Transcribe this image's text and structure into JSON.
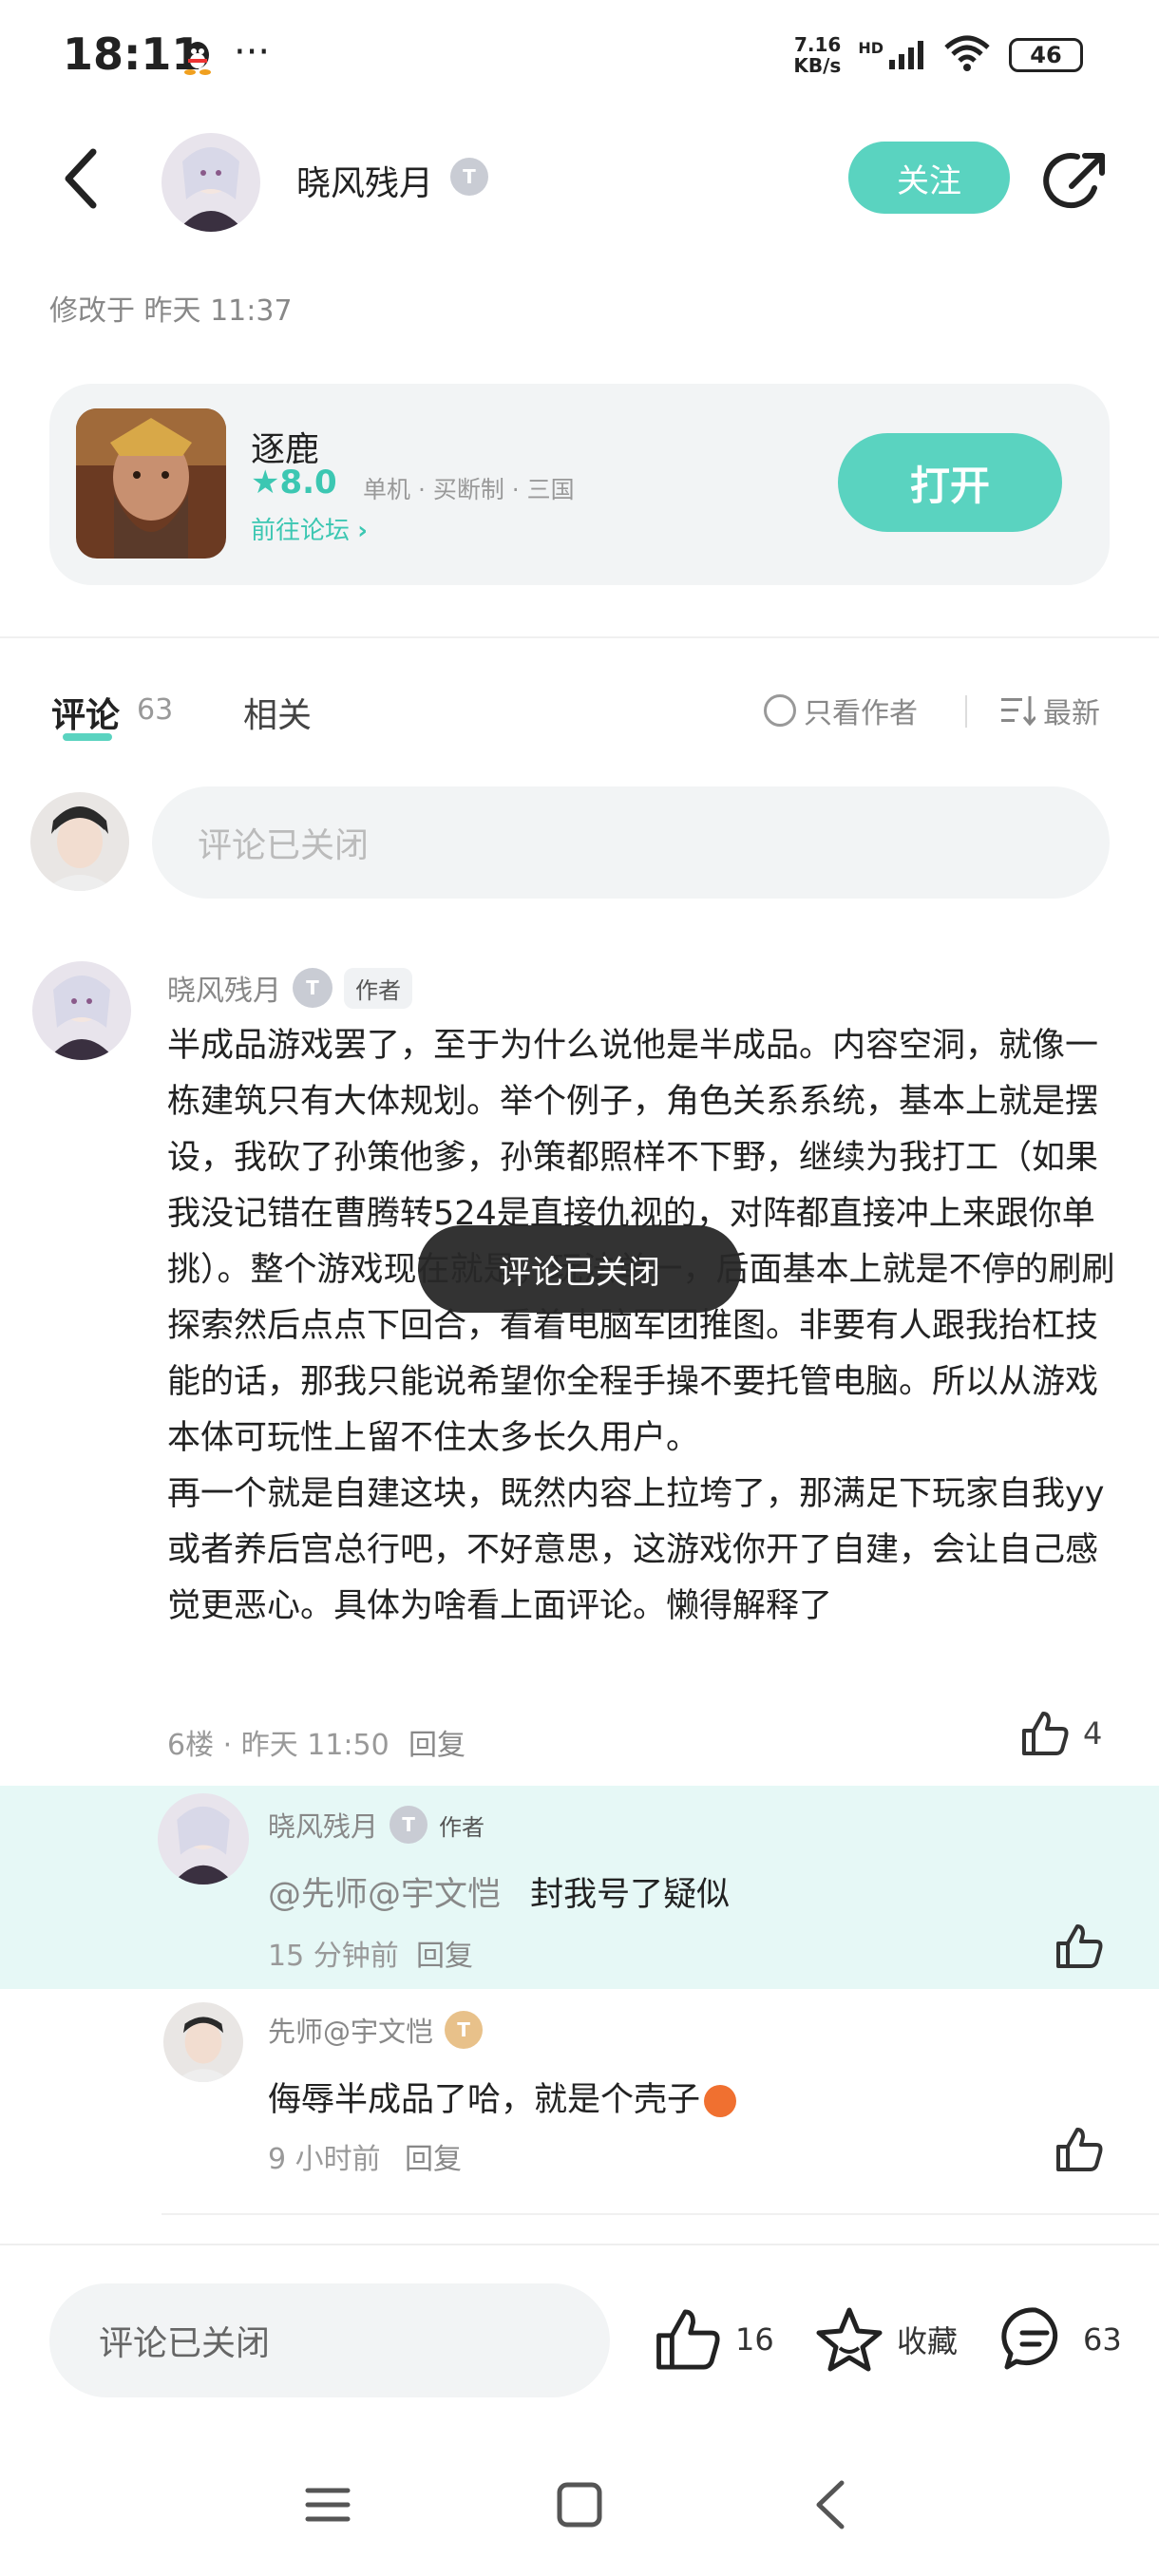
{
  "status_bar": {
    "time": "18:11",
    "dots": "···",
    "netspeed_top": "7.16",
    "netspeed_bottom": "KB/s",
    "hd": "HD",
    "battery": "46"
  },
  "header": {
    "username": "晓风残月",
    "level": "T",
    "follow_label": "关注",
    "modified": "修改于 昨天 11:37"
  },
  "game_card": {
    "name": "逐鹿",
    "rating": "8.0",
    "tags": "单机 · 买断制 · 三国",
    "forum_link": "前往论坛",
    "open_label": "打开"
  },
  "tabs": {
    "comment_label": "评论",
    "comment_count": "63",
    "related_label": "相关",
    "author_only": "只看作者",
    "sort": "最新"
  },
  "comment_input_placeholder": "评论已关闭",
  "main_comment": {
    "username": "晓风残月",
    "level": "T",
    "author_tag": "作者",
    "paragraph1": "半成品游戏罢了，至于为什么说他是半成品。内容空洞，就像一栋建筑只有大体规划。举个例子，角色关系系统，基本上就是摆设，我砍了孙策他爹，孙策都照样不下野，继续为我打工（如果我没记错在曹腾转524是直接仇视的，对阵都直接冲上来跟你单挑）。整个游戏现在就是，玩法单一，后面基本上就是不停的刷刷探索然后点点下回合，看着电脑军团推图。非要有人跟我抬杠技能的话，那我只能说希望你全程手操不要托管电脑。所以从游戏本体可玩性上留不住太多长久用户。",
    "paragraph2": "再一个就是自建这块，既然内容上拉垮了，那满足下玩家自我yy或者养后宫总行吧，不好意思，这游戏你开了自建，会让自己感觉更恶心。具体为啥看上面评论。懒得解释了",
    "meta": "6楼 · 昨天 11:50",
    "reply_label": "回复",
    "likes": "4"
  },
  "replies": [
    {
      "username": "晓风残月",
      "level": "T",
      "author_tag": "作者",
      "mention": "@先师@宇文恺",
      "text": "封我号了疑似",
      "time": "15 分钟前",
      "reply_label": "回复"
    },
    {
      "username": "先师@宇文恺",
      "level": "T",
      "text": "侮辱半成品了哈，就是个壳子",
      "time": "9 小时前",
      "reply_label": "回复"
    }
  ],
  "toast": "评论已关闭",
  "bottom_bar": {
    "input_placeholder": "评论已关闭",
    "likes": "16",
    "favorite_label": "收藏",
    "comments": "63"
  },
  "colors": {
    "accent": "#5ad3c0",
    "highlight": "#e6f8f6"
  }
}
